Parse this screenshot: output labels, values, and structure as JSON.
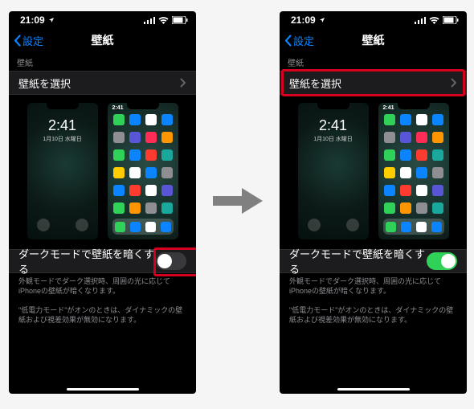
{
  "status": {
    "time": "21:09",
    "location_icon": "◤",
    "signal": "ııl",
    "wifi": "▾",
    "battery": "▮"
  },
  "nav": {
    "back_label": "設定",
    "title": "壁紙"
  },
  "section_header": "壁紙",
  "select_row": "壁紙を選択",
  "lock_preview": {
    "time": "2:41",
    "date": "1月10日 水曜日"
  },
  "home_preview": {
    "time": "2:41"
  },
  "toggle_label": "ダークモードで壁紙を暗くする",
  "footnote1": "外観モードでダーク選択時、周囲の光に応じてiPhoneの壁紙が暗くなります。",
  "footnote2": "\"低電力モード\"がオンのときは、ダイナミックの壁紙および視差効果が無効になります。",
  "left_toggle_state": "off",
  "right_toggle_state": "on",
  "app_colors": [
    "c-green",
    "c-blue",
    "c-white",
    "c-blue",
    "c-gray",
    "c-purple",
    "c-pink",
    "c-orange",
    "c-green",
    "c-blue",
    "c-red",
    "c-teal",
    "c-yellow",
    "c-white",
    "c-blue",
    "c-gray",
    "c-blue",
    "c-red",
    "c-white",
    "c-purple",
    "c-green",
    "c-orange",
    "c-gray",
    "c-teal"
  ],
  "dock_colors": [
    "c-green",
    "c-blue",
    "c-white",
    "c-blue"
  ]
}
